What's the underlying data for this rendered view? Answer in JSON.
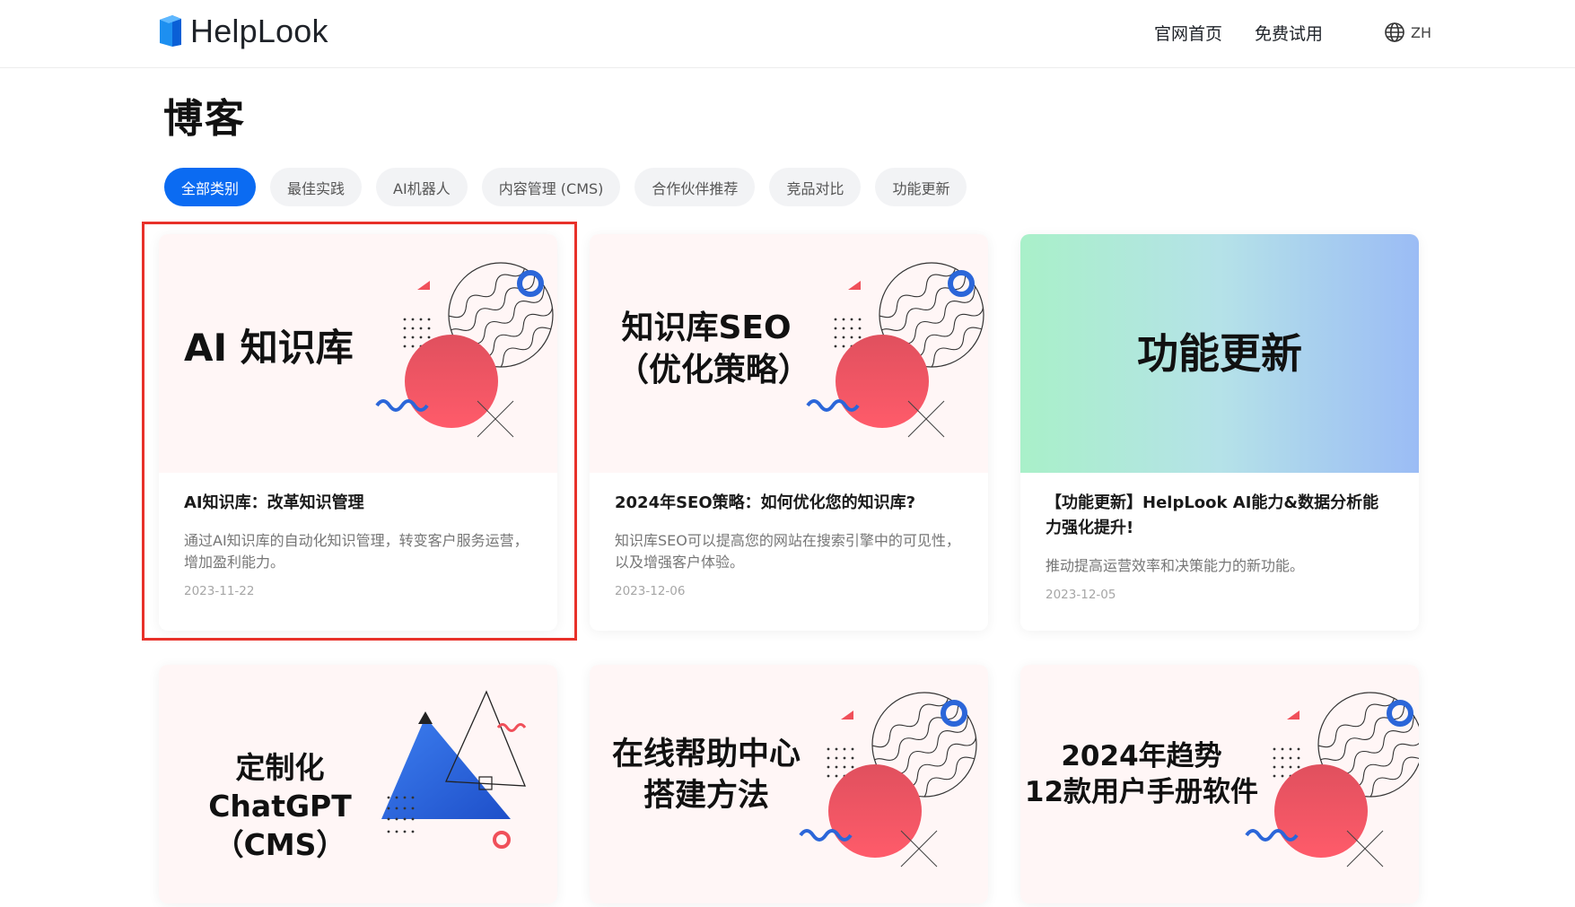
{
  "brand": {
    "name": "HelpLook"
  },
  "nav": {
    "home": "官网首页",
    "trial": "免费试用",
    "lang": "ZH"
  },
  "page": {
    "title": "博客"
  },
  "filters": [
    {
      "label": "全部类别",
      "active": true
    },
    {
      "label": "最佳实践",
      "active": false
    },
    {
      "label": "AI机器人",
      "active": false
    },
    {
      "label": "内容管理 (CMS)",
      "active": false
    },
    {
      "label": "合作伙伴推荐",
      "active": false
    },
    {
      "label": "竞品对比",
      "active": false
    },
    {
      "label": "功能更新",
      "active": false
    }
  ],
  "colors": {
    "accent": "#0b6bf2",
    "highlight": "#e8312a",
    "deco_blue": "#2b66d9",
    "deco_red": "#f0505a"
  },
  "posts": [
    {
      "cover_lines": [
        "AI 知识库"
      ],
      "title": "AI知识库：改革知识管理",
      "description": "通过AI知识库的自动化知识管理，转变客户服务运营，增加盈利能力。",
      "date": "2023-11-22"
    },
    {
      "cover_lines": [
        "知识库SEO",
        "（优化策略）"
      ],
      "title": "2024年SEO策略：如何优化您的知识库?",
      "description": "知识库SEO可以提高您的网站在搜索引擎中的可见性，以及增强客户体验。",
      "date": "2023-12-06"
    },
    {
      "cover_lines": [
        "功能更新"
      ],
      "title": "【功能更新】HelpLook AI能力&数据分析能力强化提升!",
      "description": "推动提高运营效率和决策能力的新功能。",
      "date": "2023-12-05"
    },
    {
      "cover_lines": [
        "定制化ChatGPT",
        "（CMS）"
      ]
    },
    {
      "cover_lines": [
        "在线帮助中心",
        "搭建方法"
      ]
    },
    {
      "cover_lines": [
        "2024年趋势",
        "12款用户手册软件"
      ]
    }
  ]
}
